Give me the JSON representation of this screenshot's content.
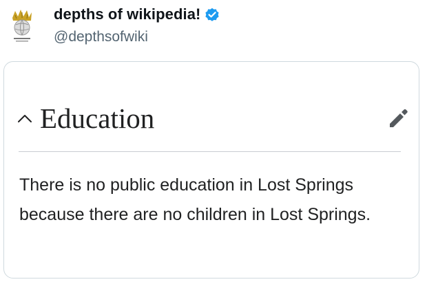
{
  "tweet": {
    "display_name": "depths of wikipedia!",
    "handle": "@depthsofwiki",
    "verified_icon": "verified-badge-icon",
    "avatar": "wikipedia-globe-logo-avatar"
  },
  "wiki_section": {
    "collapse_icon": "chevron-up-icon",
    "title": "Education",
    "edit_icon": "pencil-icon",
    "body": "There is no public education in Lost Springs because there are no children in Lost Springs."
  },
  "colors": {
    "verified_blue": "#1d9bf0",
    "handle_gray": "#536471",
    "card_border": "#cfd9de",
    "wiki_text": "#202122",
    "divider": "#c8ccd1",
    "edit_icon": "#54595d"
  }
}
